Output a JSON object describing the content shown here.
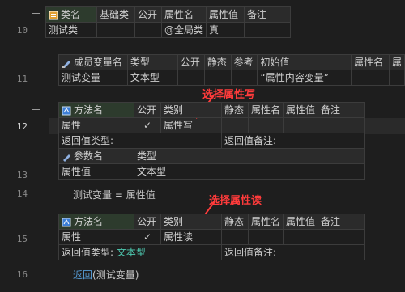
{
  "lines": [
    "10",
    "11",
    "12",
    "13",
    "14",
    "15",
    "16"
  ],
  "class_table": {
    "headers": [
      "类名",
      "基础类",
      "公开",
      "属性名",
      "属性值",
      "备注"
    ],
    "row": [
      "测试类",
      "",
      "",
      "@全局类",
      "真",
      ""
    ]
  },
  "member_table": {
    "headers": [
      "成员变量名",
      "类型",
      "公开",
      "静态",
      "参考",
      "初始值",
      "属性名",
      "属"
    ],
    "row": [
      "测试变量",
      "文本型",
      "",
      "",
      "",
      "“属性内容变量”",
      "",
      ""
    ]
  },
  "method1": {
    "headers": [
      "方法名",
      "公开",
      "类别",
      "静态",
      "属性名",
      "属性值",
      "备注"
    ],
    "row": [
      "属性",
      "✓",
      "属性写",
      "",
      "",
      "",
      ""
    ],
    "return_type_label": "返回值类型:",
    "return_type": "",
    "return_note_label": "返回值备注:",
    "param_headers": [
      "参数名",
      "类型"
    ],
    "param_row": [
      "属性值",
      "文本型"
    ]
  },
  "code_line14": {
    "left": "测试变量",
    "op": "=",
    "right": "属性值"
  },
  "method2": {
    "headers": [
      "方法名",
      "公开",
      "类别",
      "静态",
      "属性名",
      "属性值",
      "备注"
    ],
    "row": [
      "属性",
      "✓",
      "属性读",
      "",
      "",
      "",
      ""
    ],
    "return_type_label": "返回值类型:",
    "return_type": "文本型",
    "return_note_label": "返回值备注:"
  },
  "code_line16": {
    "func": "返回",
    "arg": "(测试变量)"
  },
  "annotations": {
    "write": "选择属性写",
    "read": "选择属性读"
  },
  "colors": {
    "background": "#1e1e1e",
    "type_green": "#4ec9b0",
    "keyword_blue": "#569cd6",
    "string_purple": "#c586c0",
    "annotation_red": "#ff3b3b"
  },
  "icons": [
    "class-icon",
    "member-variable-icon",
    "method-icon",
    "parameter-icon",
    "arrow-icon"
  ]
}
